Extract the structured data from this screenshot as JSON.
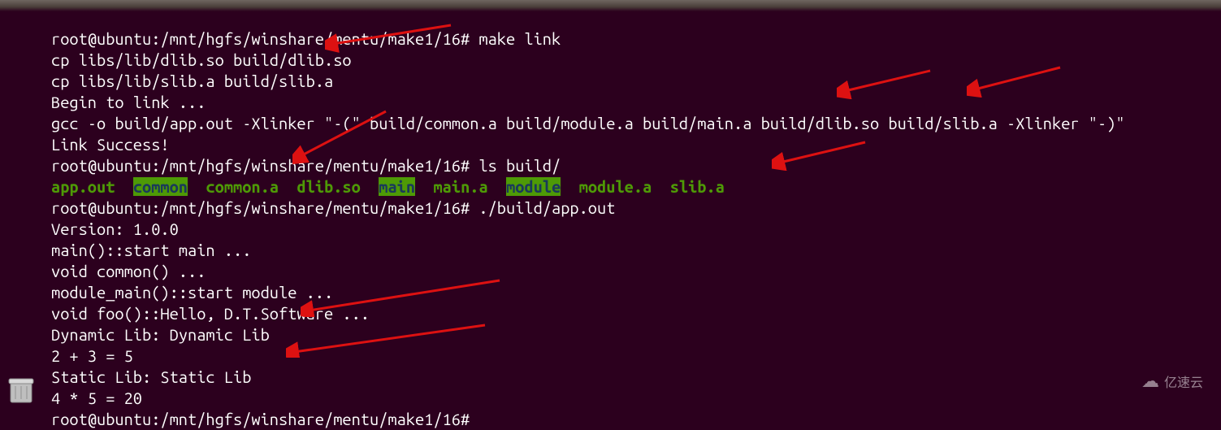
{
  "prompt1": "root@ubuntu:/mnt/hgfs/winshare/mentu/make1/16# ",
  "cmd1": "make link",
  "out1": "cp libs/lib/dlib.so build/dlib.so",
  "out2": "cp libs/lib/slib.a build/slib.a",
  "out3": "Begin to link ...",
  "out4": "gcc -o build/app.out -Xlinker \"-(\" build/common.a build/module.a build/main.a build/dlib.so build/slib.a -Xlinker \"-)\"",
  "out5": "Link Success!",
  "prompt2": "root@ubuntu:/mnt/hgfs/winshare/mentu/make1/16# ",
  "cmd2": "ls build/",
  "ls": {
    "app_out": "app.out",
    "common_dir": "common",
    "common_a": "common.a",
    "dlib_so": "dlib.so",
    "main_dir": "main",
    "main_a": "main.a",
    "module_dir": "module",
    "module_a": "module.a",
    "slib_a": "slib.a"
  },
  "prompt3": "root@ubuntu:/mnt/hgfs/winshare/mentu/make1/16# ",
  "cmd3": "./build/app.out",
  "run1": "Version: 1.0.0",
  "run2": "main()::start main ...",
  "run3": "void common() ...",
  "run4": "module_main()::start module ...",
  "run5": "void foo()::Hello, D.T.Software ...",
  "run6": "Dynamic Lib: Dynamic Lib",
  "run7": "2 + 3 = 5",
  "run8": "Static Lib: Static Lib",
  "run9": "4 * 5 = 20",
  "prompt4": "root@ubuntu:/mnt/hgfs/winshare/mentu/make1/16# ",
  "watermark": "亿速云"
}
